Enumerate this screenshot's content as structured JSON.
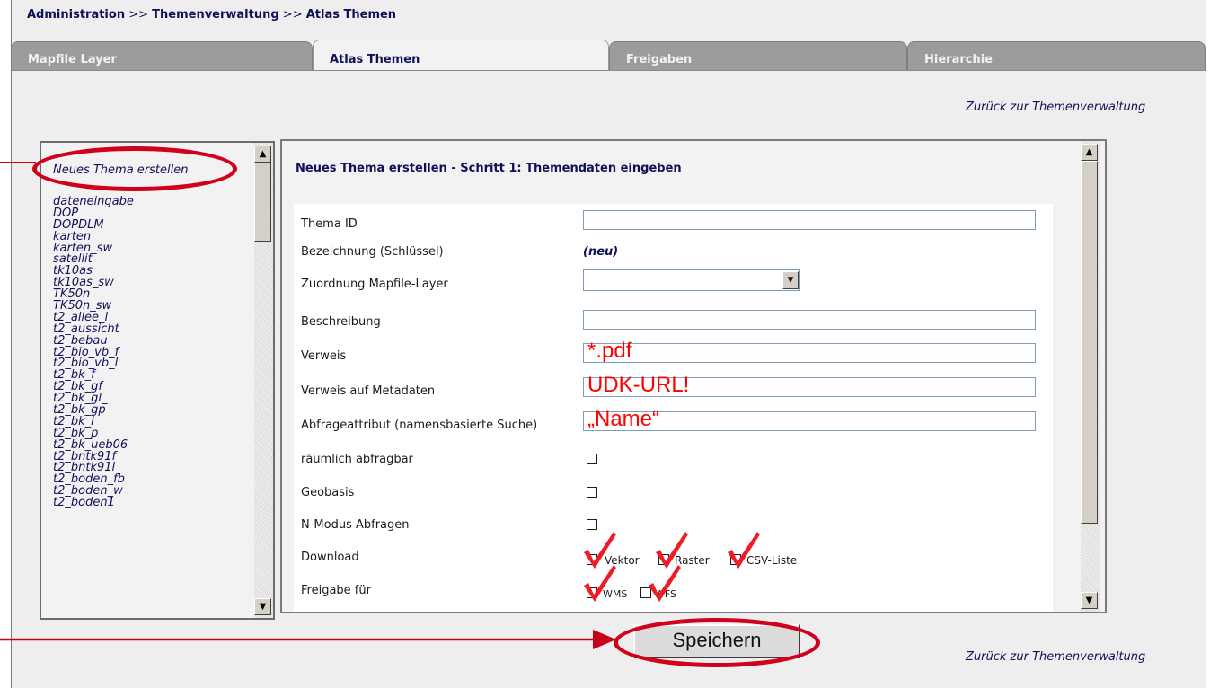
{
  "breadcrumb": {
    "part1": "Administration",
    "sep1": " >> ",
    "part2": "Themenverwaltung",
    "sep2": " >> ",
    "part3": "Atlas Themen"
  },
  "tabs": [
    {
      "label": "Mapfile Layer"
    },
    {
      "label": "Atlas Themen"
    },
    {
      "label": "Freigaben"
    },
    {
      "label": "Hierarchie"
    }
  ],
  "back_link": "Zurück zur Themenverwaltung",
  "theme_list": {
    "first": "Neues Thema erstellen",
    "items": [
      "dateneingabe",
      "DOP",
      "DOPDLM",
      "karten",
      "karten_sw",
      "satellit",
      "tk10as",
      "tk10as_sw",
      "TK50n",
      "TK50n_sw",
      "t2_allee_l",
      "t2_aussicht",
      "t2_bebau",
      "t2_bio_vb_f",
      "t2_bio_vb_l",
      "t2_bk_f",
      "t2_bk_gf",
      "t2_bk_gl_",
      "t2_bk_gp",
      "t2_bk_l",
      "t2_bk_p",
      "t2_bk_ueb06",
      "t2_bntk91f",
      "t2_bntk91l",
      "t2_boden_fb",
      "t2_boden_w",
      "t2_boden1"
    ]
  },
  "form": {
    "title": "Neues Thema erstellen - Schritt 1: Themendaten eingeben",
    "labels": {
      "thema_id": "Thema ID",
      "bezeichnung": "Bezeichnung (Schlüssel)",
      "zuordnung": "Zuordnung Mapfile-Layer",
      "beschreibung": "Beschreibung",
      "verweis": "Verweis",
      "verweis_meta": "Verweis auf Metadaten",
      "abfrage": "Abfrageattribut (namensbasierte Suche)",
      "raeumlich": "räumlich abfragbar",
      "geobasis": "Geobasis",
      "nmodus": "N-Modus Abfragen",
      "download": "Download",
      "freigabe": "Freigabe für"
    },
    "bezeichnung_value": "(neu)",
    "download_options": [
      "Vektor",
      "Raster",
      "CSV-Liste"
    ],
    "freigabe_options": [
      "WMS",
      "WFS"
    ]
  },
  "annotations": {
    "verweis": "*.pdf",
    "metadaten": "UDK-URL!",
    "abfrage": "„Name“",
    "color": "#ff0000"
  },
  "save_button": "Speichern",
  "colors": {
    "accent": "#10105a",
    "highlight": "#d0021b"
  }
}
